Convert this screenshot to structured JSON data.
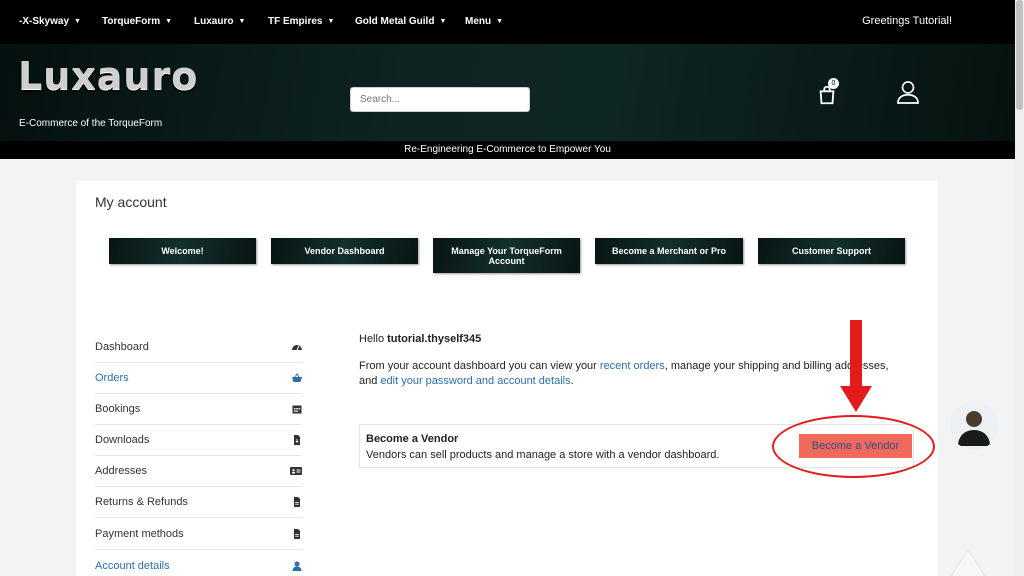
{
  "topnav": {
    "items": [
      {
        "label": "-X-Skyway"
      },
      {
        "label": "TorqueForm"
      },
      {
        "label": "Luxauro"
      },
      {
        "label": "TF Empires"
      },
      {
        "label": "Gold Metal Guild"
      },
      {
        "label": "Menu"
      }
    ],
    "greeting": "Greetings Tutorial!"
  },
  "header": {
    "logo": "Luxauro",
    "tagline": "E-Commerce of the TorqueForm",
    "search_placeholder": "Search...",
    "cart_count": "0",
    "subbar": "Re-Engineering E-Commerce to Empower You"
  },
  "page": {
    "title": "My account",
    "tabs": [
      {
        "label": "Welcome!"
      },
      {
        "label": "Vendor Dashboard"
      },
      {
        "label": "Manage Your TorqueForm Account"
      },
      {
        "label": "Become a Merchant or Pro"
      },
      {
        "label": "Customer Support"
      }
    ]
  },
  "sidebar": {
    "items": [
      {
        "label": "Dashboard",
        "icon": "gauge-icon"
      },
      {
        "label": "Orders",
        "icon": "basket-icon"
      },
      {
        "label": "Bookings",
        "icon": "calendar-icon"
      },
      {
        "label": "Downloads",
        "icon": "file-download-icon"
      },
      {
        "label": "Addresses",
        "icon": "address-card-icon"
      },
      {
        "label": "Returns & Refunds",
        "icon": "file-icon"
      },
      {
        "label": "Payment methods",
        "icon": "file-icon"
      },
      {
        "label": "Account details",
        "icon": "user-icon"
      }
    ]
  },
  "content": {
    "hello_prefix": "Hello ",
    "username": "tutorial.thyself345",
    "intro_1": "From your account dashboard you can view your ",
    "link_orders": "recent orders",
    "intro_2": ", manage your shipping and billing addresses, and ",
    "link_edit": "edit your password and account details",
    "intro_3": ".",
    "vendor_title": "Become a Vendor",
    "vendor_desc": "Vendors can sell products and manage a store with a vendor dashboard.",
    "vendor_button": "Become a Vendor"
  },
  "colors": {
    "accent_link": "#2e6fa8",
    "vendor_button": "#ef6a5c",
    "callout": "#e21b1b"
  }
}
